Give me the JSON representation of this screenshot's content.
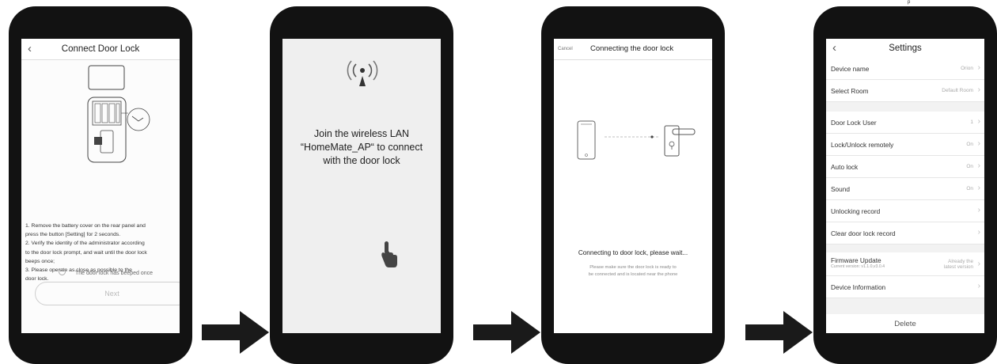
{
  "screen1": {
    "back_icon": "‹",
    "title": "Connect Door Lock",
    "instructions": [
      "1. Remove the battery cover on the rear panel and",
      "press the button [Setting] for 2 seconds.",
      "2. Verify the identity of the administrator according",
      "to the door lock prompt, and wait until the door lock",
      "beeps once;",
      "3. Please operate as close as possible to the",
      "door lock."
    ],
    "checkbox_label": "The door lock has beeped once",
    "next_button": "Next"
  },
  "screen2": {
    "message_lines": [
      "Join the wireless LAN",
      "“HomeMate_AP“ to connect",
      "with the door lock"
    ]
  },
  "screen3": {
    "cancel": "Cancel",
    "title": "Connecting the door lock",
    "status": "Connecting to door lock, please wait...",
    "sub_lines": [
      "Please make sure the door lock is ready to",
      "be connected and is located near the phone"
    ]
  },
  "screen4": {
    "back_icon": "‹",
    "title": "Settings",
    "rows": [
      {
        "label": "Device name",
        "value": "Orion"
      },
      {
        "label": "Select Room",
        "value": "Default Room"
      },
      {
        "label": "Door Lock User",
        "value": "1"
      },
      {
        "label": "Lock/Unlock remotely",
        "value": "On"
      },
      {
        "label": "Auto lock",
        "value": "On"
      },
      {
        "label": "Sound",
        "value": "On"
      },
      {
        "label": "Unlocking record",
        "value": ""
      },
      {
        "label": "Clear door lock record",
        "value": ""
      }
    ],
    "firmware": {
      "label": "Firmware Update",
      "version": "Current version: v1.1.0,v3.0.4",
      "status_line1": "Already the",
      "status_line2": "latest version"
    },
    "device_info": "Device Information",
    "delete": "Delete",
    "chevron": "›"
  },
  "top_right_text": "p"
}
